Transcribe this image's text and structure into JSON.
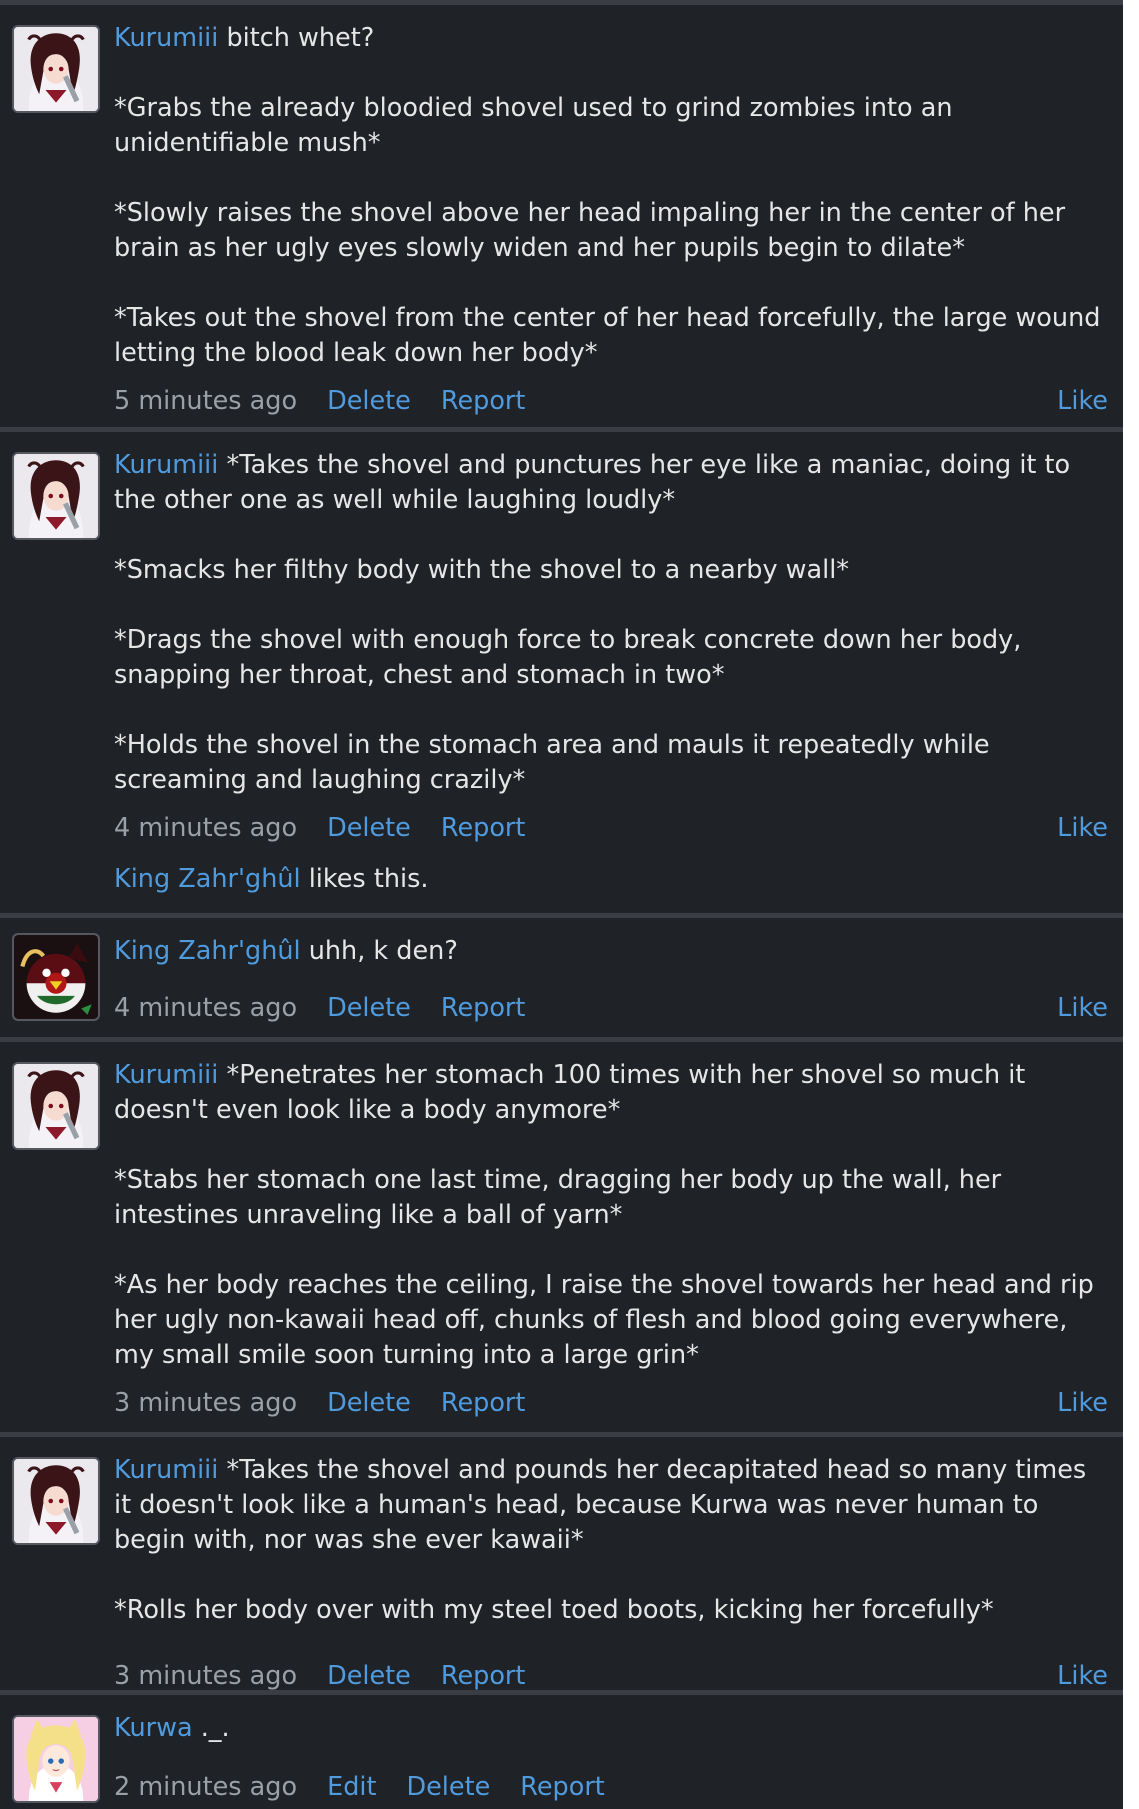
{
  "comments": [
    {
      "author": "Kurumiii",
      "avatar": "anime-girl-avatar",
      "paragraphs": [
        "bitch whet?",
        "*Grabs the already bloodied shovel used to grind zombies into an unidentifiable mush*",
        "*Slowly raises the shovel above her head impaling her in the center of her brain as her ugly eyes slowly widen and her pupils begin to dilate*",
        "*Takes out the shovel from the center of her head forcefully, the large wound letting the blood leak down her body*"
      ],
      "time": "5 minutes ago",
      "actions": [
        "Delete",
        "Report"
      ],
      "like": "Like"
    },
    {
      "author": "Kurumiii",
      "avatar": "anime-girl-avatar",
      "paragraphs": [
        "*Takes the shovel and punctures her eye like a maniac, doing it to the other one as well while laughing loudly*",
        "*Smacks her filthy body with the shovel to a nearby wall*",
        "*Drags the shovel with enough force to break concrete down her body, snapping her throat, chest and stomach in two*",
        "*Holds the shovel in the stomach area and mauls it repeatedly while screaming and laughing crazily*"
      ],
      "time": "4 minutes ago",
      "actions": [
        "Delete",
        "Report"
      ],
      "like": "Like",
      "likes": {
        "name": "King Zahr'ghûl",
        "suffix": "likes this."
      }
    },
    {
      "author": "King Zahr'ghûl",
      "avatar": "countryball-avatar",
      "paragraphs": [
        "uhh, k den?"
      ],
      "time": "4 minutes ago",
      "actions": [
        "Delete",
        "Report"
      ],
      "like": "Like"
    },
    {
      "author": "Kurumiii",
      "avatar": "anime-girl-avatar",
      "paragraphs": [
        "*Penetrates her stomach 100 times with her shovel so much it doesn't even look like a body anymore*",
        "*Stabs her stomach one last time, dragging her body up the wall, her intestines unraveling like a ball of yarn*",
        "*As her body reaches the ceiling, I raise the shovel towards her head and rip her ugly non-kawaii head off, chunks of flesh and blood going everywhere, my small smile soon turning into a large grin*"
      ],
      "time": "3 minutes ago",
      "actions": [
        "Delete",
        "Report"
      ],
      "like": "Like"
    },
    {
      "author": "Kurumiii",
      "avatar": "anime-girl-avatar",
      "paragraphs": [
        "*Takes the shovel and pounds her decapitated head so many times it doesn't look like a human's head, because Kurwa was never human to begin with, nor was she ever kawaii*",
        "*Rolls her body over with my steel toed boots, kicking her forcefully*"
      ],
      "time": "3 minutes ago",
      "actions": [
        "Delete",
        "Report"
      ],
      "like": "Like"
    },
    {
      "author": "Kurwa",
      "avatar": "blonde-cat-girl-avatar",
      "paragraphs": [
        "._."
      ],
      "time": "2 minutes ago",
      "actions": [
        "Edit",
        "Delete",
        "Report"
      ]
    }
  ]
}
